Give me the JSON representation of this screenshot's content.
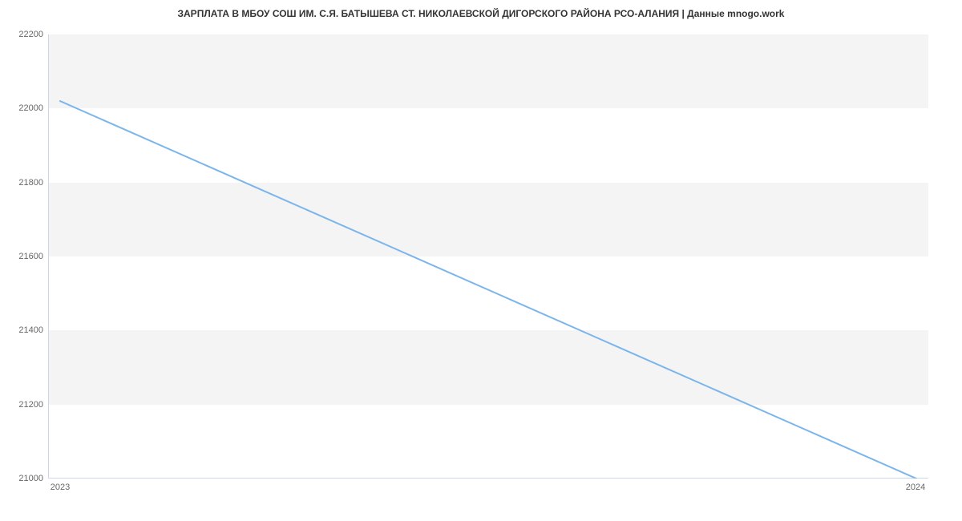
{
  "chart_data": {
    "type": "line",
    "title": "ЗАРПЛАТА В МБОУ СОШ ИМ. С.Я. БАТЫШЕВА СТ. НИКОЛАЕВСКОЙ ДИГОРСКОГО РАЙОНА РСО-АЛАНИЯ | Данные mnogo.work",
    "x": [
      2023,
      2024
    ],
    "values": [
      22020,
      21000
    ],
    "xlabel": "",
    "ylabel": "",
    "ylim": [
      21000,
      22200
    ],
    "y_ticks": [
      21000,
      21200,
      21400,
      21600,
      21800,
      22000,
      22200
    ],
    "x_ticks": [
      2023,
      2024
    ],
    "line_color": "#7cb5ec"
  }
}
